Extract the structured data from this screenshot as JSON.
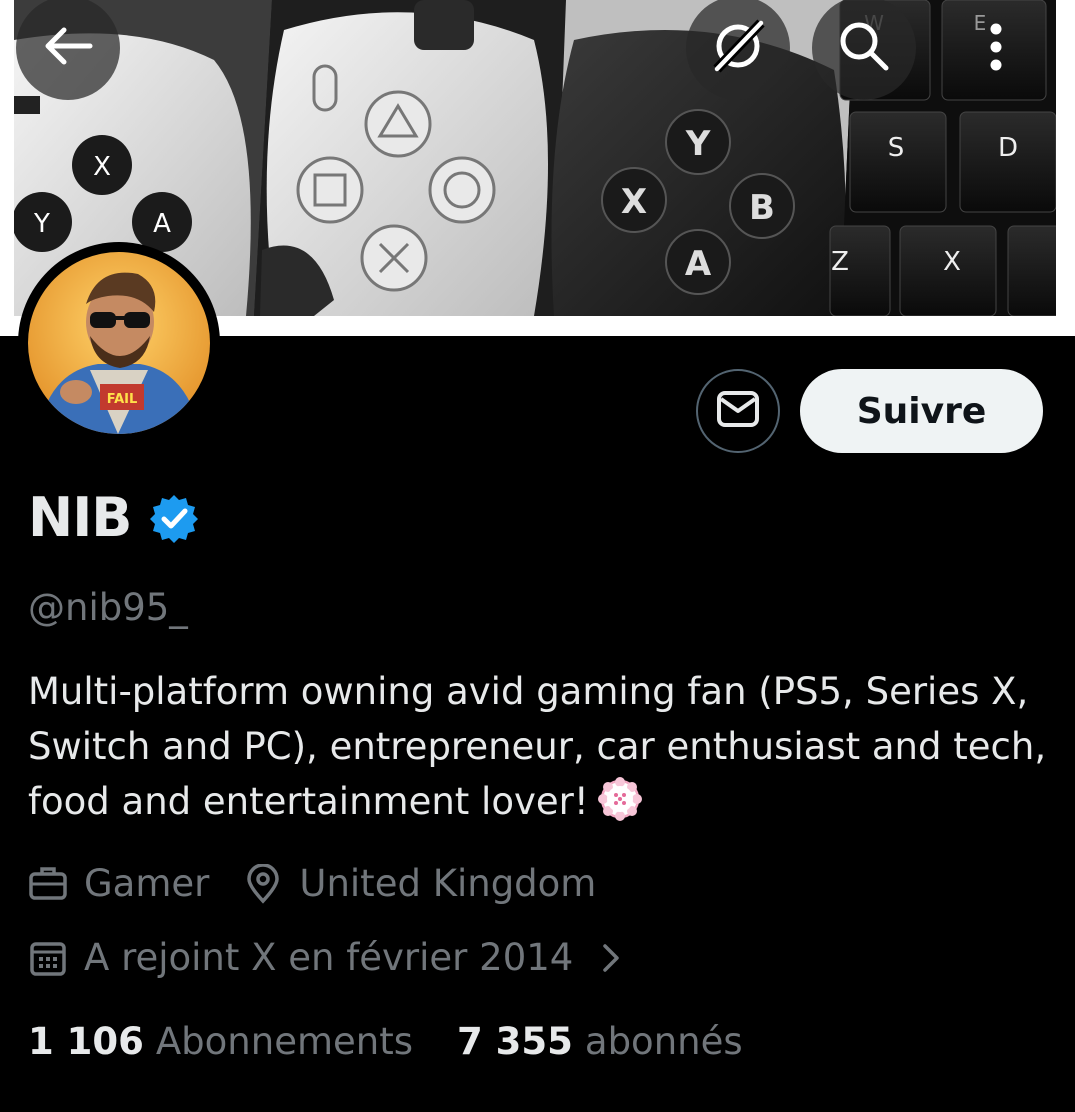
{
  "header": {
    "back_icon": "arrow-left-icon",
    "grok_icon": "grok-slash-icon",
    "search_icon": "search-icon",
    "more_icon": "more-vertical-icon"
  },
  "banner": {
    "description_keys": [
      "X",
      "Y",
      "A",
      "B",
      "S",
      "D",
      "Z",
      "W",
      "E"
    ]
  },
  "actions": {
    "message_icon": "envelope-icon",
    "follow_label": "Suivre"
  },
  "profile": {
    "display_name": "NIB",
    "verified": true,
    "verified_color": "#1d9bf0",
    "handle": "@nib95_",
    "bio": "Multi-platform owning avid gaming fan (PS5, Series X, Switch and PC), entrepreneur, car enthusiast and tech, food and entertainment lover!",
    "bio_emoji": "cherry-blossom-emoji",
    "profession": "Gamer",
    "location": "United Kingdom",
    "joined": "A rejoint X en février 2014"
  },
  "stats": {
    "following_count": "1 106",
    "following_label": "Abonnements",
    "followers_count": "7 355",
    "followers_label": "abonnés"
  },
  "colors": {
    "background": "#000000",
    "text_primary": "#e7e9ea",
    "text_secondary": "#71767b",
    "follow_bg": "#eff3f4",
    "border": "#536471"
  }
}
